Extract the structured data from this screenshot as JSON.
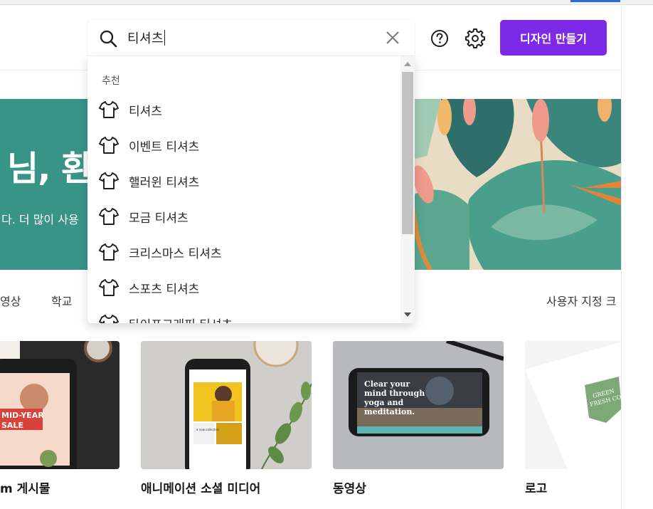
{
  "search": {
    "query": "티셔츠",
    "section_label": "추천",
    "suggestions": [
      "티셔츠",
      "이벤트 티셔츠",
      "핼러윈 티셔츠",
      "모금 티셔츠",
      "크리스마스 티셔츠",
      "스포츠 티셔츠",
      "타이포그래피 티셔츠"
    ]
  },
  "header": {
    "create_label": "디자인 만들기"
  },
  "banner": {
    "greeting": "님, 환",
    "subtitle": "다. 더 많이 사용"
  },
  "tabs": {
    "video": "영상",
    "school": "학교",
    "custom": "사용자 지정 크"
  },
  "cards": [
    {
      "title": "m 게시물",
      "sale_text": "MID-YEAR SALE"
    },
    {
      "title": "애니메이션 소셜 미디어",
      "phone_text": "a new collection"
    },
    {
      "title": "동영상",
      "phone_text": "Clear your mind through yoga and meditation."
    },
    {
      "title": "로고",
      "logo_text": "GREEN FRESH CO."
    }
  ],
  "colors": {
    "accent": "#7d2ae8",
    "banner": "#389487"
  }
}
